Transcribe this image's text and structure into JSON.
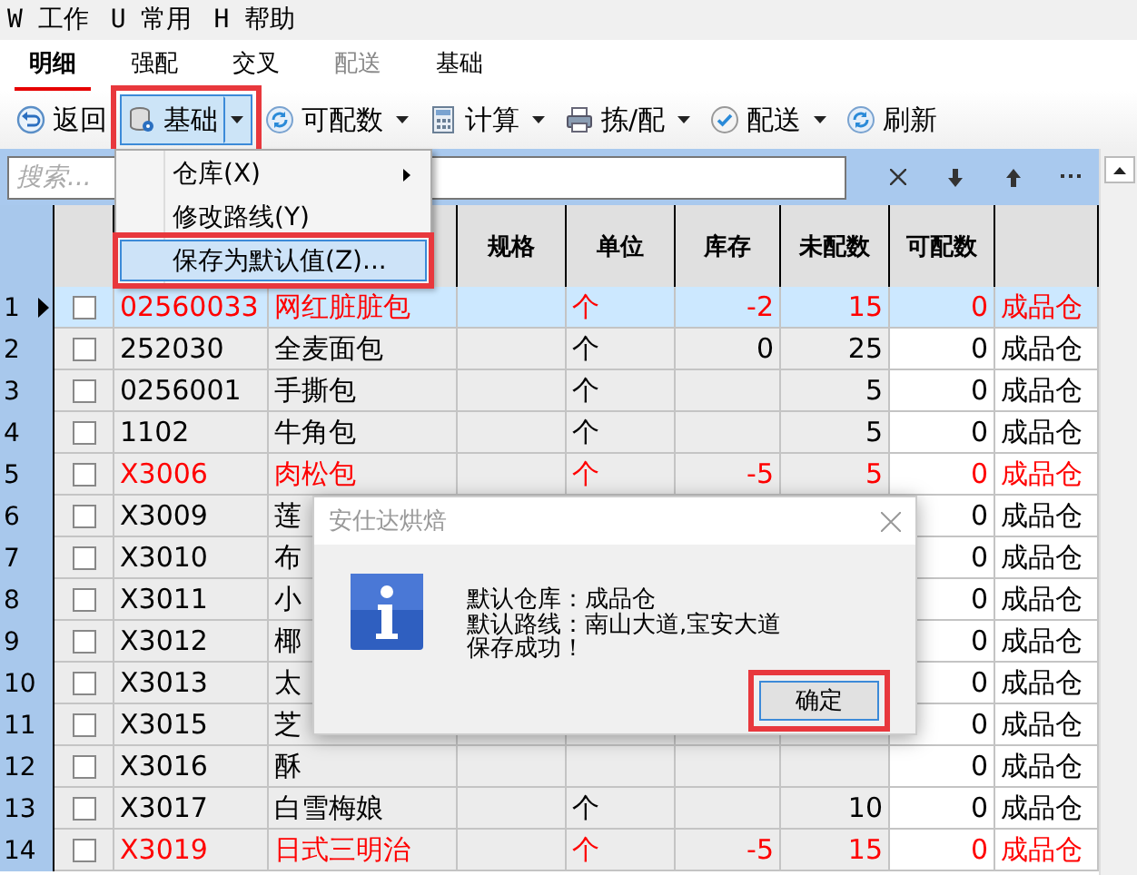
{
  "menu_bar": [
    "W 工作",
    "U 常用",
    "H 帮助"
  ],
  "tabs": [
    {
      "label": "明细",
      "selected": true,
      "disabled": false
    },
    {
      "label": "强配",
      "selected": false,
      "disabled": false
    },
    {
      "label": "交叉",
      "selected": false,
      "disabled": false
    },
    {
      "label": "配送",
      "selected": false,
      "disabled": true
    },
    {
      "label": "基础",
      "selected": false,
      "disabled": false
    }
  ],
  "toolbar": [
    {
      "label": "返回",
      "dropdown": false,
      "pressed": false
    },
    {
      "label": "基础",
      "dropdown": true,
      "pressed": true
    },
    {
      "label": "可配数",
      "dropdown": true,
      "pressed": false
    },
    {
      "label": "计算",
      "dropdown": true,
      "pressed": false
    },
    {
      "label": "拣/配",
      "dropdown": true,
      "pressed": false
    },
    {
      "label": "配送",
      "dropdown": true,
      "pressed": false
    },
    {
      "label": "刷新",
      "dropdown": false,
      "pressed": false
    }
  ],
  "search": {
    "placeholder": "搜索..."
  },
  "dropdown_menu": [
    {
      "label": "仓库(X)",
      "submenu": true,
      "selected": false
    },
    {
      "label": "修改路线(Y)",
      "submenu": false,
      "selected": false
    },
    {
      "label": "保存为默认值(Z)...",
      "submenu": false,
      "selected": true
    }
  ],
  "table": {
    "columns": [
      "规格",
      "单位",
      "库存",
      "未配数",
      "可配数"
    ],
    "rows": [
      {
        "no": "1",
        "selected": true,
        "checked": false,
        "alert": true,
        "code": "02560033",
        "name": "网红脏脏包",
        "unit": "个",
        "stock": "-2",
        "pending": "15",
        "available": "0",
        "warehouse": "成品仓"
      },
      {
        "no": "2",
        "selected": false,
        "checked": false,
        "alert": false,
        "code": "252030",
        "name": "全麦面包",
        "unit": "个",
        "stock": "0",
        "pending": "25",
        "available": "0",
        "warehouse": "成品仓"
      },
      {
        "no": "3",
        "selected": false,
        "checked": false,
        "alert": false,
        "code": "0256001",
        "name": "手撕包",
        "unit": "个",
        "pending": "5",
        "available": "0",
        "warehouse": "成品仓"
      },
      {
        "no": "4",
        "selected": false,
        "checked": false,
        "alert": false,
        "code": "1102",
        "name": "牛角包",
        "unit": "个",
        "pending": "5",
        "available": "0",
        "warehouse": "成品仓"
      },
      {
        "no": "5",
        "selected": false,
        "checked": false,
        "alert": true,
        "code": "X3006",
        "name": "肉松包",
        "unit": "个",
        "stock": "-5",
        "pending": "5",
        "available": "0",
        "warehouse": "成品仓"
      },
      {
        "no": "6",
        "selected": false,
        "checked": false,
        "alert": false,
        "code": "X3009",
        "name": "莲",
        "available": "0",
        "warehouse": "成品仓"
      },
      {
        "no": "7",
        "selected": false,
        "checked": false,
        "alert": false,
        "code": "X3010",
        "name": "布",
        "available": "0",
        "warehouse": "成品仓"
      },
      {
        "no": "8",
        "selected": false,
        "checked": false,
        "alert": false,
        "code": "X3011",
        "name": "小",
        "available": "0",
        "warehouse": "成品仓"
      },
      {
        "no": "9",
        "selected": false,
        "checked": false,
        "alert": false,
        "code": "X3012",
        "name": "椰",
        "available": "0",
        "warehouse": "成品仓"
      },
      {
        "no": "10",
        "selected": false,
        "checked": false,
        "alert": false,
        "code": "X3013",
        "name": "太",
        "available": "0",
        "warehouse": "成品仓"
      },
      {
        "no": "11",
        "selected": false,
        "checked": false,
        "alert": false,
        "code": "X3015",
        "name": "芝",
        "available": "0",
        "warehouse": "成品仓"
      },
      {
        "no": "12",
        "selected": false,
        "checked": false,
        "alert": false,
        "code": "X3016",
        "name": "酥",
        "available": "0",
        "warehouse": "成品仓"
      },
      {
        "no": "13",
        "selected": false,
        "checked": false,
        "alert": false,
        "code": "X3017",
        "name": "白雪梅娘",
        "unit": "个",
        "pending": "10",
        "available": "0",
        "warehouse": "成品仓"
      },
      {
        "no": "14",
        "selected": false,
        "checked": false,
        "alert": true,
        "code": "X3019",
        "name": "日式三明治",
        "unit": "个",
        "stock": "-5",
        "pending": "15",
        "available": "0",
        "warehouse": "成品仓"
      }
    ]
  },
  "dialog": {
    "title": "安仕达烘焙",
    "lines": [
      "默认仓库：成品仓",
      "默认路线：南山大道,宝安大道",
      "保存成功！"
    ],
    "button": "确定"
  }
}
